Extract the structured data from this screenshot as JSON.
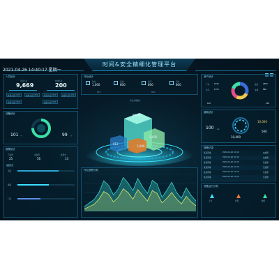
{
  "header": {
    "title": "时间&安全精细化管理平台",
    "datetime": "2021-04-26 14:40:17 星期一"
  },
  "left_top": {
    "title": "人员统计",
    "stats": [
      {
        "label": "当日人员",
        "value": "9,669"
      },
      {
        "label": "在线人员",
        "value": "200"
      }
    ],
    "chips": [
      {
        "label": "外部人员",
        "value": "1,000"
      },
      {
        "label": "内部人员",
        "value": "1,000"
      },
      {
        "label": "外部人员",
        "value": "1,000"
      },
      {
        "label": "内部人员",
        "value": "1,000"
      },
      {
        "label": "外部人员",
        "value": "1,000"
      },
      {
        "label": "内部人员",
        "value": "1,000"
      }
    ]
  },
  "left_mid": {
    "title": "设备统计",
    "gauge_pct": 0.75,
    "left_value": "101",
    "left_unit": "个",
    "right_value": "99",
    "right_unit": "个"
  },
  "left_bottom": {
    "title": "报警统计",
    "items": [
      {
        "label": "已处理",
        "value": "25"
      },
      {
        "label": "未处理",
        "value": "56"
      },
      {
        "label": "处理中",
        "value": "13"
      }
    ],
    "bars_title": "报警类型",
    "bars": [
      {
        "label": "温度",
        "value": 0.72
      },
      {
        "label": "烟感",
        "value": 0.55
      },
      {
        "label": "门禁",
        "value": 0.4
      }
    ]
  },
  "center_top": {
    "title": "作业统计",
    "cards": [
      {
        "label": "作业",
        "value": "1,000"
      },
      {
        "label": "完成",
        "value": "800"
      },
      {
        "label": "进行",
        "value": "800"
      },
      {
        "label": "待办",
        "value": "800"
      }
    ],
    "percents": [
      "87%",
      "80%"
    ],
    "subtitle": "作业分类统计"
  },
  "center_chart": {
    "title": "作业趋势分析"
  },
  "right_top": {
    "title": "资产统计",
    "left_labels": [
      "厂房",
      "仓库"
    ],
    "left_values": [
      "1445",
      "1753"
    ],
    "right_labels": [
      "设备",
      "车辆"
    ],
    "right_values": [
      "2563",
      "862"
    ],
    "bottom_left": "100",
    "bottom_right": "100"
  },
  "right_mid": {
    "title": "能耗统计",
    "left_value": "100",
    "left_unit": "kw",
    "center_value": "10,400",
    "right_values": [
      "10,000",
      "500"
    ]
  },
  "right_list": {
    "title": "报警记录",
    "rows": [
      {
        "name": "某某区域",
        "time": "2021-04-26 10:40",
        "status": "未处理"
      },
      {
        "name": "某某区域",
        "time": "2021-04-26 10:40",
        "status": "未处理"
      },
      {
        "name": "某某区域",
        "time": "2021-04-26 10:40",
        "status": "已处理"
      },
      {
        "name": "某某区域",
        "time": "2021-04-26 10:40",
        "status": "已处理"
      },
      {
        "name": "某某区域",
        "time": "2021-04-26 10:40",
        "status": "已处理"
      },
      {
        "name": "某某区域",
        "time": "2021-04-26 10:40",
        "status": "已处理"
      }
    ]
  },
  "right_bottom": {
    "title": "设备运行分析",
    "markers": [
      "正常",
      "预警",
      "故障"
    ]
  },
  "cubes": {
    "tall": "网格化管理",
    "right": "3,000",
    "left": "612",
    "mid": "1,000"
  },
  "chart_data": {
    "type": "area",
    "series": [
      {
        "values": [
          10,
          18,
          25,
          40,
          65,
          55,
          35,
          48,
          72,
          60,
          44,
          70,
          52,
          38,
          66,
          58,
          30,
          45,
          62,
          40,
          28,
          50,
          34,
          22
        ]
      },
      {
        "values": [
          5,
          10,
          15,
          26,
          42,
          36,
          20,
          30,
          48,
          40,
          26,
          46,
          34,
          22,
          44,
          38,
          18,
          28,
          40,
          26,
          16,
          32,
          20,
          12
        ]
      }
    ],
    "ylim": [
      0,
      80
    ],
    "colors": [
      "#39d3c8",
      "#d7e86a"
    ]
  }
}
